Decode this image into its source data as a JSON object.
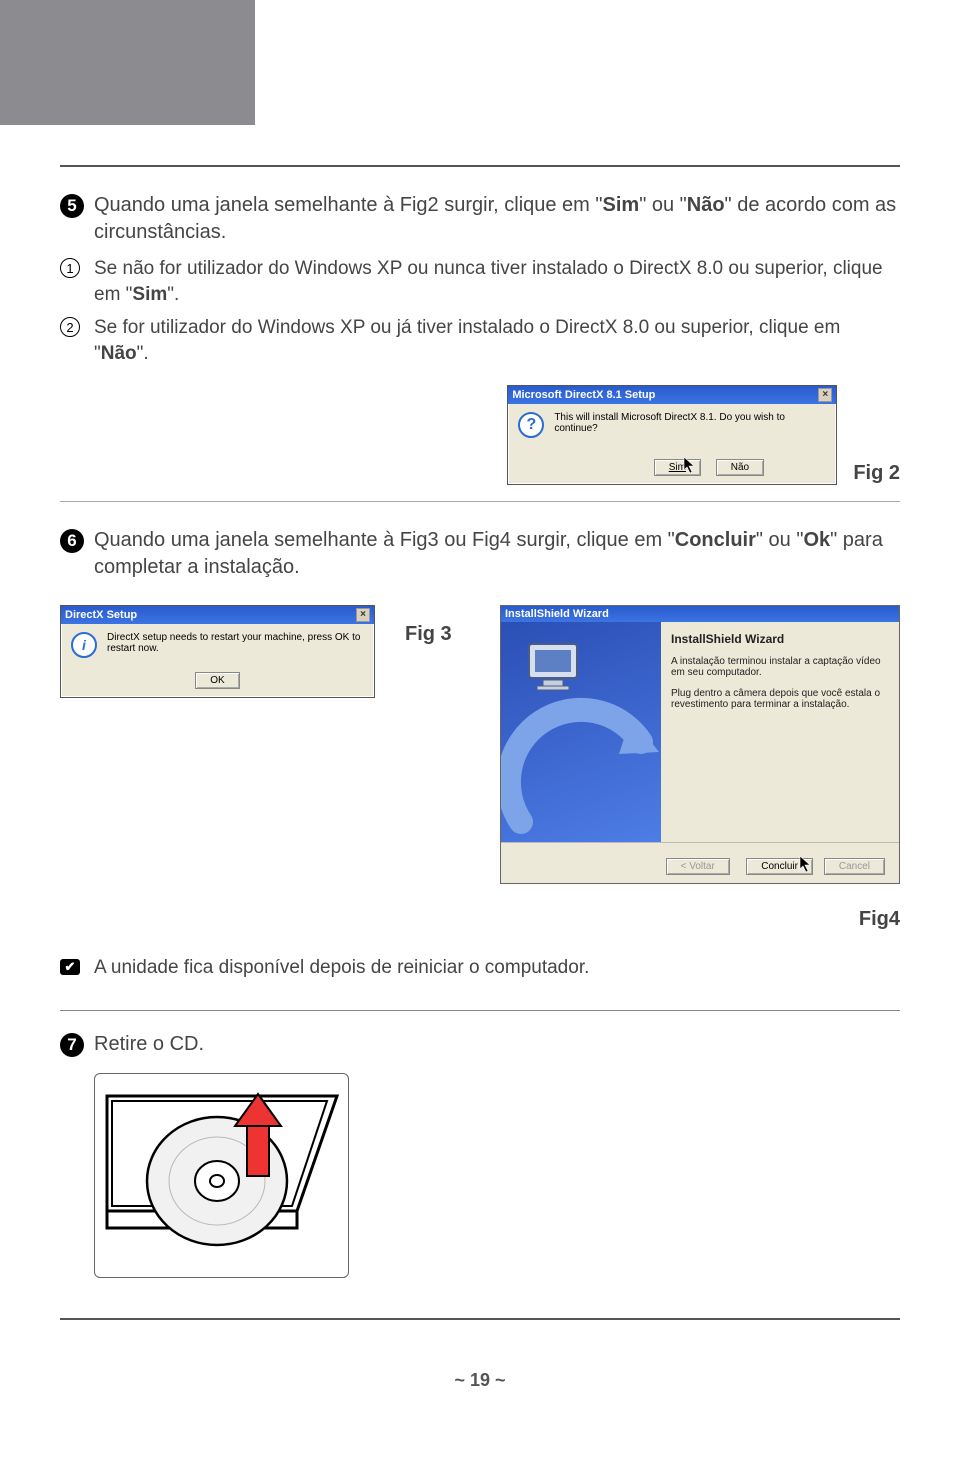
{
  "step5": {
    "num": "5",
    "text_a": "Quando uma janela semelhante à Fig2 surgir, clique em \"",
    "text_b": "\" ou \"",
    "text_c": "\" de acordo com as circunstâncias.",
    "bold_sim": "Sim",
    "bold_nao": "Não",
    "sub1_num": "1",
    "sub1_a": "Se não for utilizador do Windows XP ou nunca tiver instalado o DirectX 8.0 ou superior, clique em \"",
    "sub1_bold": "Sim",
    "sub1_b": "\".",
    "sub2_num": "2",
    "sub2_a": "Se for utilizador do Windows XP ou já tiver instalado o DirectX 8.0 ou superior, clique em \"",
    "sub2_bold": "Não",
    "sub2_b": "\"."
  },
  "fig2": {
    "label": "Fig 2",
    "title": "Microsoft DirectX 8.1 Setup",
    "msg": "This will install Microsoft DirectX 8.1. Do you wish to continue?",
    "btn_sim": "Sim",
    "btn_nao": "Não"
  },
  "step6": {
    "num": "6",
    "text_a": "Quando uma janela semelhante à Fig3 ou Fig4 surgir, clique em \"",
    "bold_concluir": "Concluir",
    "text_b": "\" ou \"",
    "bold_ok": "Ok",
    "text_c": "\" para completar a instalação."
  },
  "fig3": {
    "label": "Fig 3",
    "title": "DirectX Setup",
    "msg": "DirectX setup needs to restart your machine, press OK to restart now.",
    "btn_ok": "OK"
  },
  "fig4": {
    "label": "Fig4",
    "title": "InstallShield Wizard",
    "heading": "InstallShield Wizard",
    "line1": "A instalação terminou instalar a captação vídeo em seu computador.",
    "line2": "Plug dentro a câmera depois que você estala o revestimento para terminar a instalação.",
    "btn_voltar": "< Voltar",
    "btn_concluir": "Concluir",
    "btn_cancel": "Cancel"
  },
  "note": {
    "text": "A unidade fica disponível depois de reiniciar o computador."
  },
  "step7": {
    "num": "7",
    "text": "Retire o CD."
  },
  "footer": "~ 19 ~"
}
